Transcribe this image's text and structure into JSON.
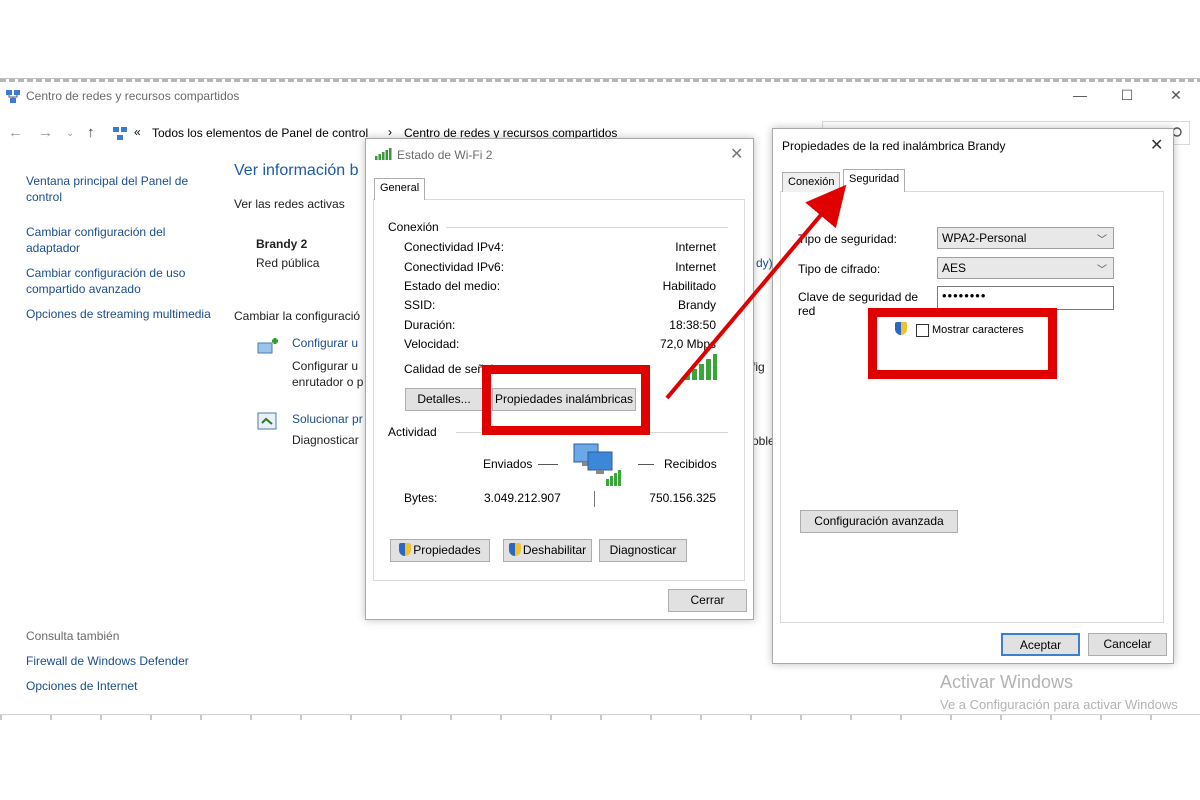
{
  "control_panel": {
    "title": "Centro de redes y recursos compartidos",
    "breadcrumb": {
      "root": "Todos los elementos de Panel de control",
      "current": "Centro de redes y recursos compartidos"
    },
    "sidebar": {
      "links": [
        "Ventana principal del Panel de control",
        "Cambiar configuración del adaptador",
        "Cambiar configuración de uso compartido avanzado",
        "Opciones de streaming multimedia"
      ],
      "see_also_heading": "Consulta también",
      "see_also": [
        "Firewall de Windows Defender",
        "Opciones de Internet"
      ]
    },
    "main": {
      "heading": "Ver información b",
      "active_networks": "Ver las redes activas",
      "network_name": "Brandy 2",
      "network_type": "Red pública",
      "partial_conn": "dy)",
      "change_config": "Cambiar la configuració",
      "setup_link": "Configurar u",
      "setup_desc_1": "Configurar u",
      "setup_desc_2": "enrutador o p",
      "setup_partial": "fig",
      "troubleshoot_link": "Solucionar pr",
      "troubleshoot_desc": "Diagnosticar",
      "troubleshoot_partial": "oble"
    },
    "watermark": {
      "line1": "Activar Windows",
      "line2": "Ve a Configuración para activar Windows"
    }
  },
  "wifi_status": {
    "title": "Estado de Wi-Fi 2",
    "tab": "General",
    "connection_heading": "Conexión",
    "rows": [
      {
        "label": "Conectividad IPv4:",
        "value": "Internet"
      },
      {
        "label": "Conectividad IPv6:",
        "value": "Internet"
      },
      {
        "label": "Estado del medio:",
        "value": "Habilitado"
      },
      {
        "label": "SSID:",
        "value": "Brandy"
      },
      {
        "label": "Duración:",
        "value": "18:38:50"
      },
      {
        "label": "Velocidad:",
        "value": "72,0 Mbps"
      }
    ],
    "signal_label": "Calidad de señal:",
    "details_button": "Detalles...",
    "wireless_props_button": "Propiedades inalámbricas",
    "activity_heading": "Actividad",
    "sent_label": "Enviados",
    "received_label": "Recibidos",
    "bytes_label": "Bytes:",
    "bytes_sent": "3.049.212.907",
    "bytes_received": "750.156.325",
    "properties_button": "Propiedades",
    "disable_button": "Deshabilitar",
    "diagnose_button": "Diagnosticar",
    "close_button": "Cerrar"
  },
  "wireless_props": {
    "title": "Propiedades de la red inalámbrica Brandy",
    "tabs": [
      "Conexión",
      "Seguridad"
    ],
    "security_type_label": "Tipo de seguridad:",
    "security_type_value": "WPA2-Personal",
    "encryption_label": "Tipo de cifrado:",
    "encryption_value": "AES",
    "key_label": "Clave de seguridad de red",
    "key_value": "••••••••",
    "show_chars_label": "Mostrar caracteres",
    "advanced_button": "Configuración avanzada",
    "accept_button": "Aceptar",
    "cancel_button": "Cancelar"
  },
  "annotation_color": "#e00000"
}
